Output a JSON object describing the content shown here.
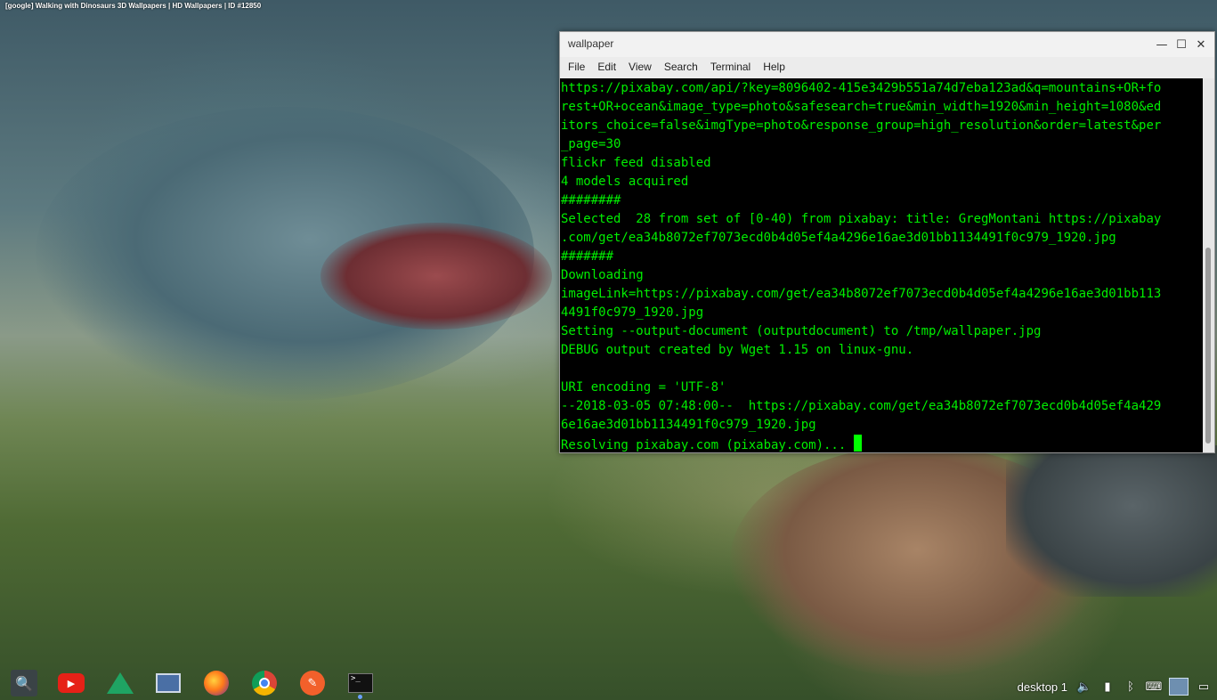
{
  "desktop": {
    "top_title": "[google] Walking with Dinosaurs 3D Wallpapers | HD Wallpapers | ID #12850"
  },
  "window": {
    "title": "wallpaper",
    "controls": {
      "minimize": "—",
      "maximize": "☐",
      "close": "✕"
    },
    "menu": [
      "File",
      "Edit",
      "View",
      "Search",
      "Terminal",
      "Help"
    ]
  },
  "terminal": {
    "lines": [
      "https://pixabay.com/api/?key=8096402-415e3429b551a74d7eba123ad&q=mountains+OR+fo",
      "rest+OR+ocean&image_type=photo&safesearch=true&min_width=1920&min_height=1080&ed",
      "itors_choice=false&imgType=photo&response_group=high_resolution&order=latest&per",
      "_page=30",
      "flickr feed disabled",
      "4 models acquired",
      "########",
      "Selected  28 from set of [0-40) from pixabay: title: GregMontani https://pixabay",
      ".com/get/ea34b8072ef7073ecd0b4d05ef4a4296e16ae3d01bb1134491f0c979_1920.jpg",
      "#######",
      "Downloading",
      "imageLink=https://pixabay.com/get/ea34b8072ef7073ecd0b4d05ef4a4296e16ae3d01bb113",
      "4491f0c979_1920.jpg",
      "Setting --output-document (outputdocument) to /tmp/wallpaper.jpg",
      "DEBUG output created by Wget 1.15 on linux-gnu.",
      "",
      "URI encoding = 'UTF-8'",
      "--2018-03-05 07:48:00--  https://pixabay.com/get/ea34b8072ef7073ecd0b4d05ef4a429",
      "6e16ae3d01bb1134491f0c979_1920.jpg"
    ],
    "prompt_line": "Resolving pixabay.com (pixabay.com)... ",
    "text_color": "#00ee00",
    "background": "#000000"
  },
  "taskbar": {
    "launchers": [
      {
        "name": "search-icon",
        "glyph": "🔍"
      },
      {
        "name": "youtube-icon",
        "glyph": "▶"
      },
      {
        "name": "google-drive-icon"
      },
      {
        "name": "sheets-icon"
      },
      {
        "name": "firefox-icon"
      },
      {
        "name": "chrome-icon"
      },
      {
        "name": "tool-icon",
        "glyph": "✎"
      },
      {
        "name": "terminal-icon",
        "glyph": ">_"
      }
    ],
    "tray": {
      "desktop_label": "desktop 1",
      "icons": [
        "volume-icon",
        "battery-icon",
        "bluetooth-icon",
        "keyboard-icon",
        "user-avatar",
        "display-icon"
      ]
    }
  }
}
